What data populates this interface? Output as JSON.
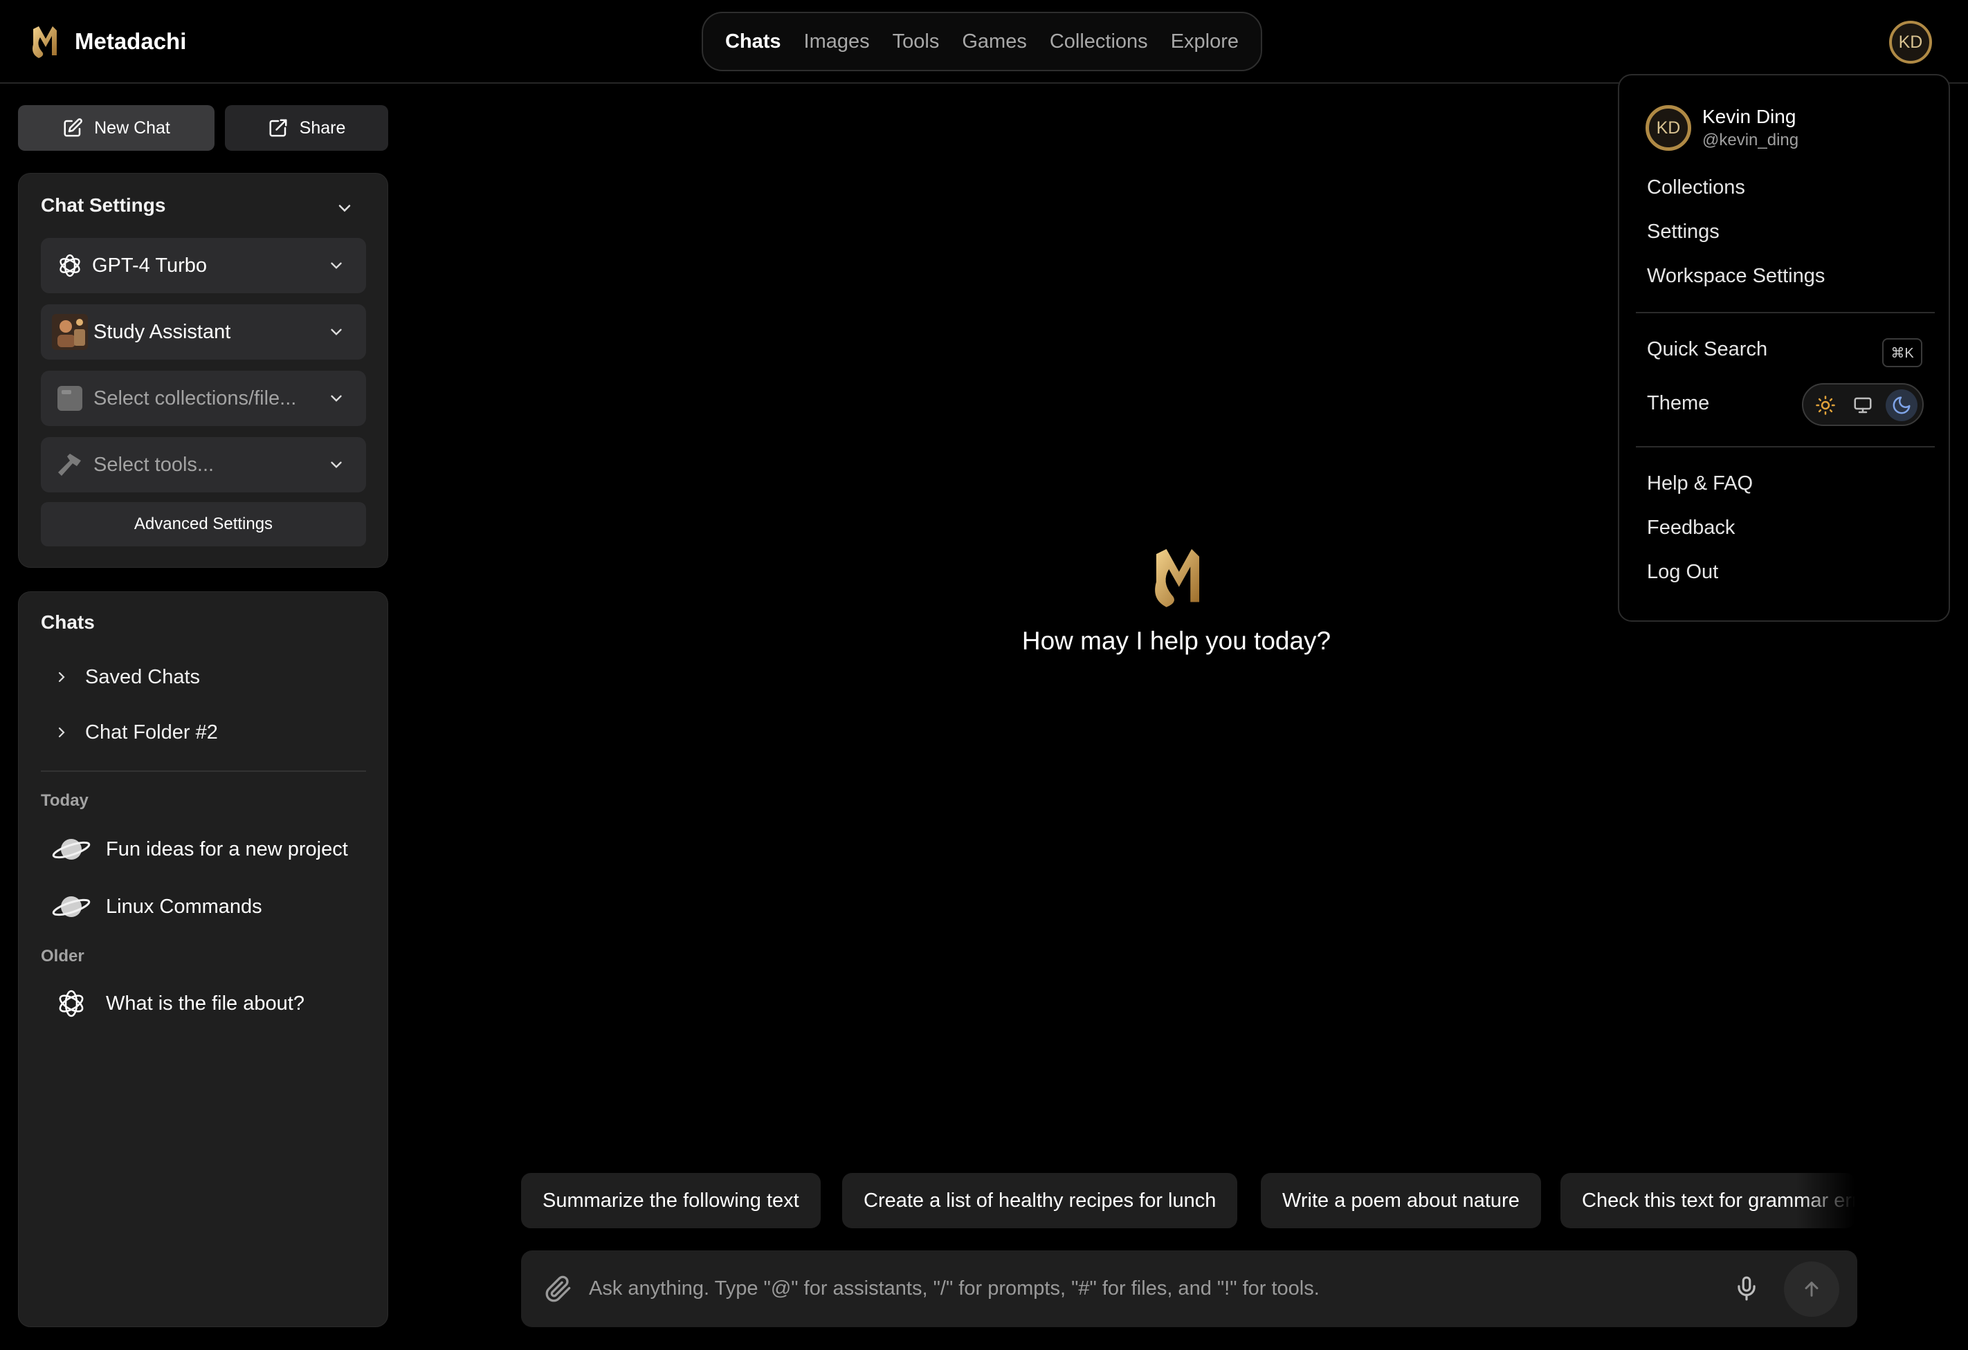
{
  "app": {
    "name": "Metadachi"
  },
  "nav": {
    "items": [
      "Chats",
      "Images",
      "Tools",
      "Games",
      "Collections",
      "Explore"
    ],
    "active": "Chats"
  },
  "user": {
    "initials": "KD",
    "name": "Kevin Ding",
    "handle": "@kevin_ding"
  },
  "sidebar": {
    "new_chat": "New Chat",
    "share": "Share",
    "chat_settings": {
      "title": "Chat Settings",
      "model": "GPT-4 Turbo",
      "assistant": "Study Assistant",
      "collections_placeholder": "Select collections/file...",
      "tools_placeholder": "Select tools...",
      "advanced": "Advanced Settings"
    },
    "chats": {
      "title": "Chats",
      "folders": [
        "Saved Chats",
        "Chat Folder #2"
      ],
      "today_label": "Today",
      "today": [
        "Fun ideas for a new project",
        "Linux Commands"
      ],
      "older_label": "Older",
      "older": [
        "What is the file about?"
      ]
    }
  },
  "main": {
    "greeting": "How may I help you today?",
    "suggestions": [
      "Summarize the following text",
      "Create a list of healthy recipes for lunch",
      "Write a poem about nature",
      "Check this text for grammar errors"
    ],
    "input_placeholder": "Ask anything. Type \"@\" for assistants, \"/\" for prompts, \"#\" for files, and \"!\" for tools."
  },
  "menu": {
    "items_top": [
      "Collections",
      "Settings",
      "Workspace Settings"
    ],
    "quick_search": "Quick Search",
    "quick_search_shortcut": "⌘K",
    "theme": "Theme",
    "theme_selected": "dark",
    "items_bottom": [
      "Help & FAQ",
      "Feedback",
      "Log Out"
    ]
  },
  "colors": {
    "accent_gold": "#b08a45",
    "background": "#000000",
    "panel": "#1f1f1f",
    "control": "#2c2c2e"
  }
}
